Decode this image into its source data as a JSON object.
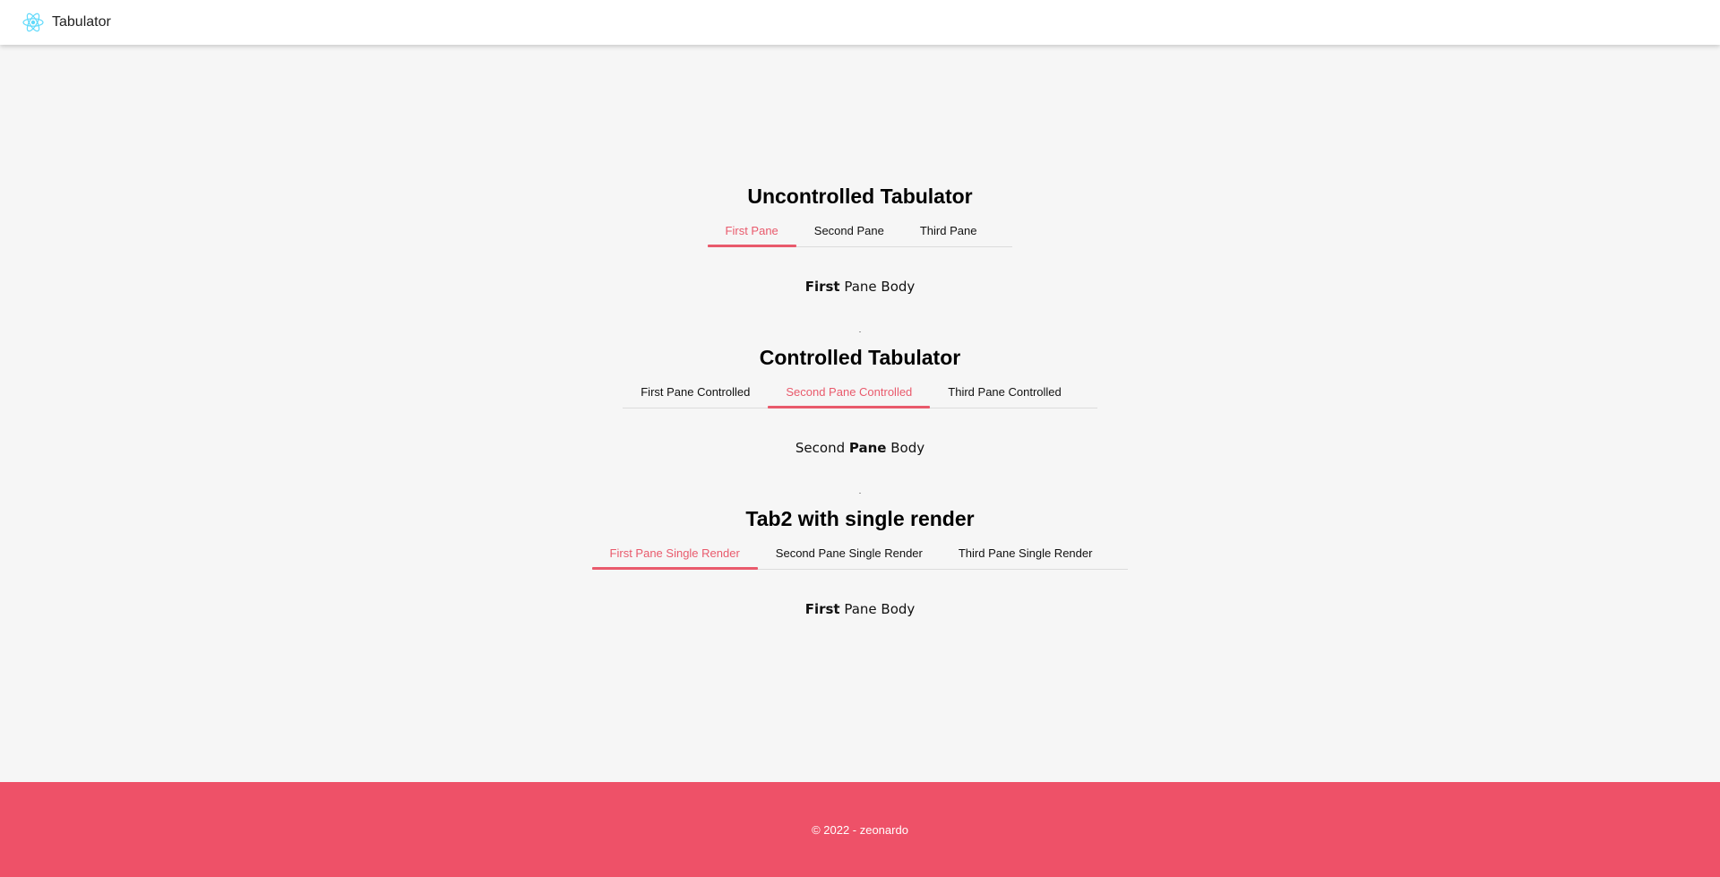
{
  "header": {
    "logo_icon": "react-atom-icon",
    "title": "Tabulator"
  },
  "sections": [
    {
      "title": "Uncontrolled Tabulator",
      "tabs": [
        {
          "label": "First Pane",
          "active": true
        },
        {
          "label": "Second Pane",
          "active": false
        },
        {
          "label": "Third Pane",
          "active": false
        }
      ],
      "body": {
        "bold": "First",
        "rest": " Pane Body"
      }
    },
    {
      "title": "Controlled Tabulator",
      "tabs": [
        {
          "label": "First Pane Controlled",
          "active": false
        },
        {
          "label": "Second Pane Controlled",
          "active": true
        },
        {
          "label": "Third Pane Controlled",
          "active": false
        }
      ],
      "body": {
        "pre": "Second ",
        "bold": "Pane",
        "post": " Body"
      }
    },
    {
      "title": "Tab2 with single render",
      "tabs": [
        {
          "label": "First Pane Single Render",
          "active": true
        },
        {
          "label": "Second Pane Single Render",
          "active": false
        },
        {
          "label": "Third Pane Single Render",
          "active": false
        }
      ],
      "body": {
        "bold": "First",
        "rest": " Pane Body"
      }
    }
  ],
  "colors": {
    "accent": "#e95a6c",
    "footer_bg": "#ee5168",
    "page_bg": "#f6f6f6"
  },
  "footer": {
    "text": "© 2022 - zeonardo"
  }
}
